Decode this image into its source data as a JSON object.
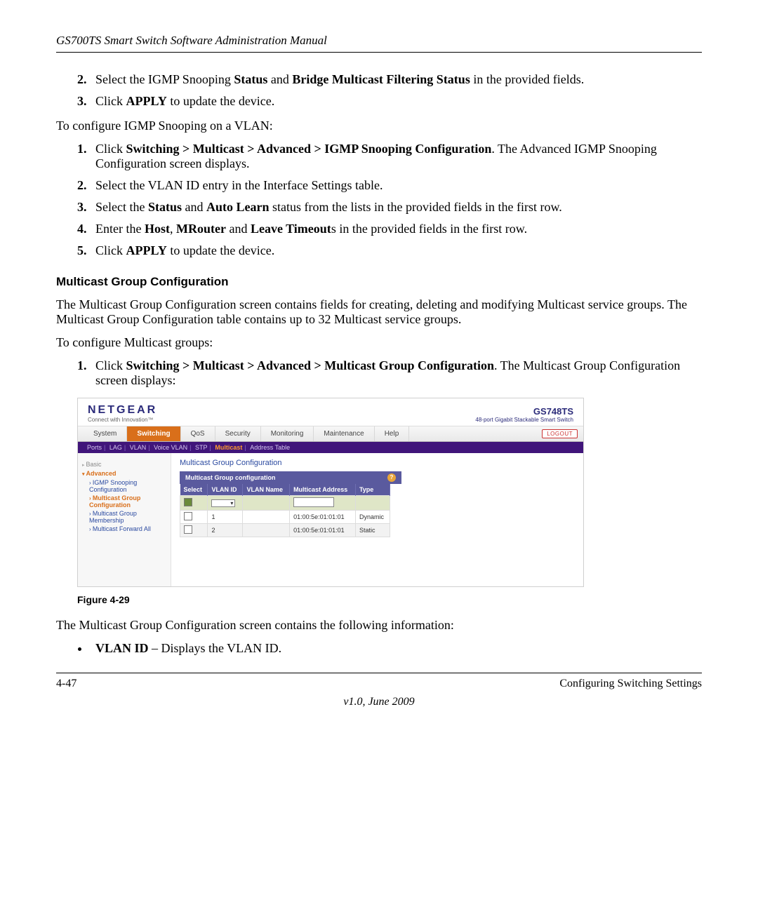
{
  "doc_header": "GS700TS Smart Switch Software Administration Manual",
  "steps_top": [
    {
      "pre": "Select the IGMP Snooping ",
      "b1": "Status",
      "mid": " and ",
      "b2": "Bridge Multicast Filtering Status",
      "post": " in the provided fields."
    },
    {
      "pre": "Click ",
      "b1": "APPLY",
      "mid": "",
      "b2": "",
      "post": " to update the device."
    }
  ],
  "intro1": "To configure IGMP Snooping on a VLAN:",
  "steps_vlan": [
    {
      "pre": "Click ",
      "b1": "Switching > Multicast > Advanced > IGMP Snooping Configuration",
      "mid": ". The Advanced IGMP Snooping Configuration screen displays.",
      "b2": "",
      "post": ""
    },
    {
      "pre": "Select the VLAN ID entry in the Interface Settings table.",
      "b1": "",
      "mid": "",
      "b2": "",
      "post": ""
    },
    {
      "pre": "Select the ",
      "b1": "Status",
      "mid": " and ",
      "b2": "Auto Learn",
      "post": " status from the lists in the provided fields in the first row."
    },
    {
      "pre": "Enter the ",
      "b1": "Host",
      "mid": ", ",
      "b2": "MRouter",
      "post2": " and ",
      "b3": "Leave Timeout",
      "post": "s in the provided fields in the first row."
    },
    {
      "pre": "Click ",
      "b1": "APPLY",
      "mid": "",
      "b2": "",
      "post": " to update the device."
    }
  ],
  "section_heading": "Multicast Group Configuration",
  "section_para": "The Multicast Group Configuration screen contains fields for creating, deleting and modifying Multicast service groups. The Multicast Group Configuration table contains up to 32 Multicast service groups.",
  "intro2": "To configure Multicast groups:",
  "steps_group": [
    {
      "pre": "Click ",
      "b1": "Switching > Multicast > Advanced > Multicast Group Configuration",
      "mid": ". The Multicast Group Configuration screen displays:",
      "b2": "",
      "post": ""
    }
  ],
  "screenshot": {
    "brand": "NETGEAR",
    "brand_tag": "Connect with Innovation™",
    "model": "GS748TS",
    "model_desc": "48-port Gigabit Stackable Smart Switch",
    "logout": "LOGOUT",
    "main_tabs": [
      "System",
      "Switching",
      "QoS",
      "Security",
      "Monitoring",
      "Maintenance",
      "Help"
    ],
    "active_main": 1,
    "subtabs": [
      "Ports",
      "LAG",
      "VLAN",
      "Voice VLAN",
      "STP",
      "Multicast",
      "Address Table"
    ],
    "active_sub": 5,
    "sidebar": {
      "basic": "Basic",
      "advanced": "Advanced",
      "items": [
        "IGMP Snooping Configuration",
        "Multicast Group Configuration",
        "Multicast Group Membership",
        "Multicast Forward All"
      ],
      "active": 1
    },
    "page_title": "Multicast Group Configuration",
    "panel_title": "Multicast Group configuration",
    "columns": [
      "Select",
      "VLAN ID",
      "VLAN Name",
      "Multicast Address",
      "Type"
    ],
    "rows": [
      {
        "sel": false,
        "vlan": "1",
        "name": "",
        "addr": "01:00:5e:01:01:01",
        "type": "Dynamic"
      },
      {
        "sel": false,
        "vlan": "2",
        "name": "",
        "addr": "01:00:5e:01:01:01",
        "type": "Static"
      }
    ]
  },
  "figure_caption": "Figure 4-29",
  "after_fig": "The Multicast Group Configuration screen contains the following information:",
  "bullet": {
    "b": "VLAN ID",
    "rest": " – Displays the VLAN ID."
  },
  "footer": {
    "left": "4-47",
    "right": "Configuring Switching Settings",
    "version": "v1.0, June 2009"
  }
}
